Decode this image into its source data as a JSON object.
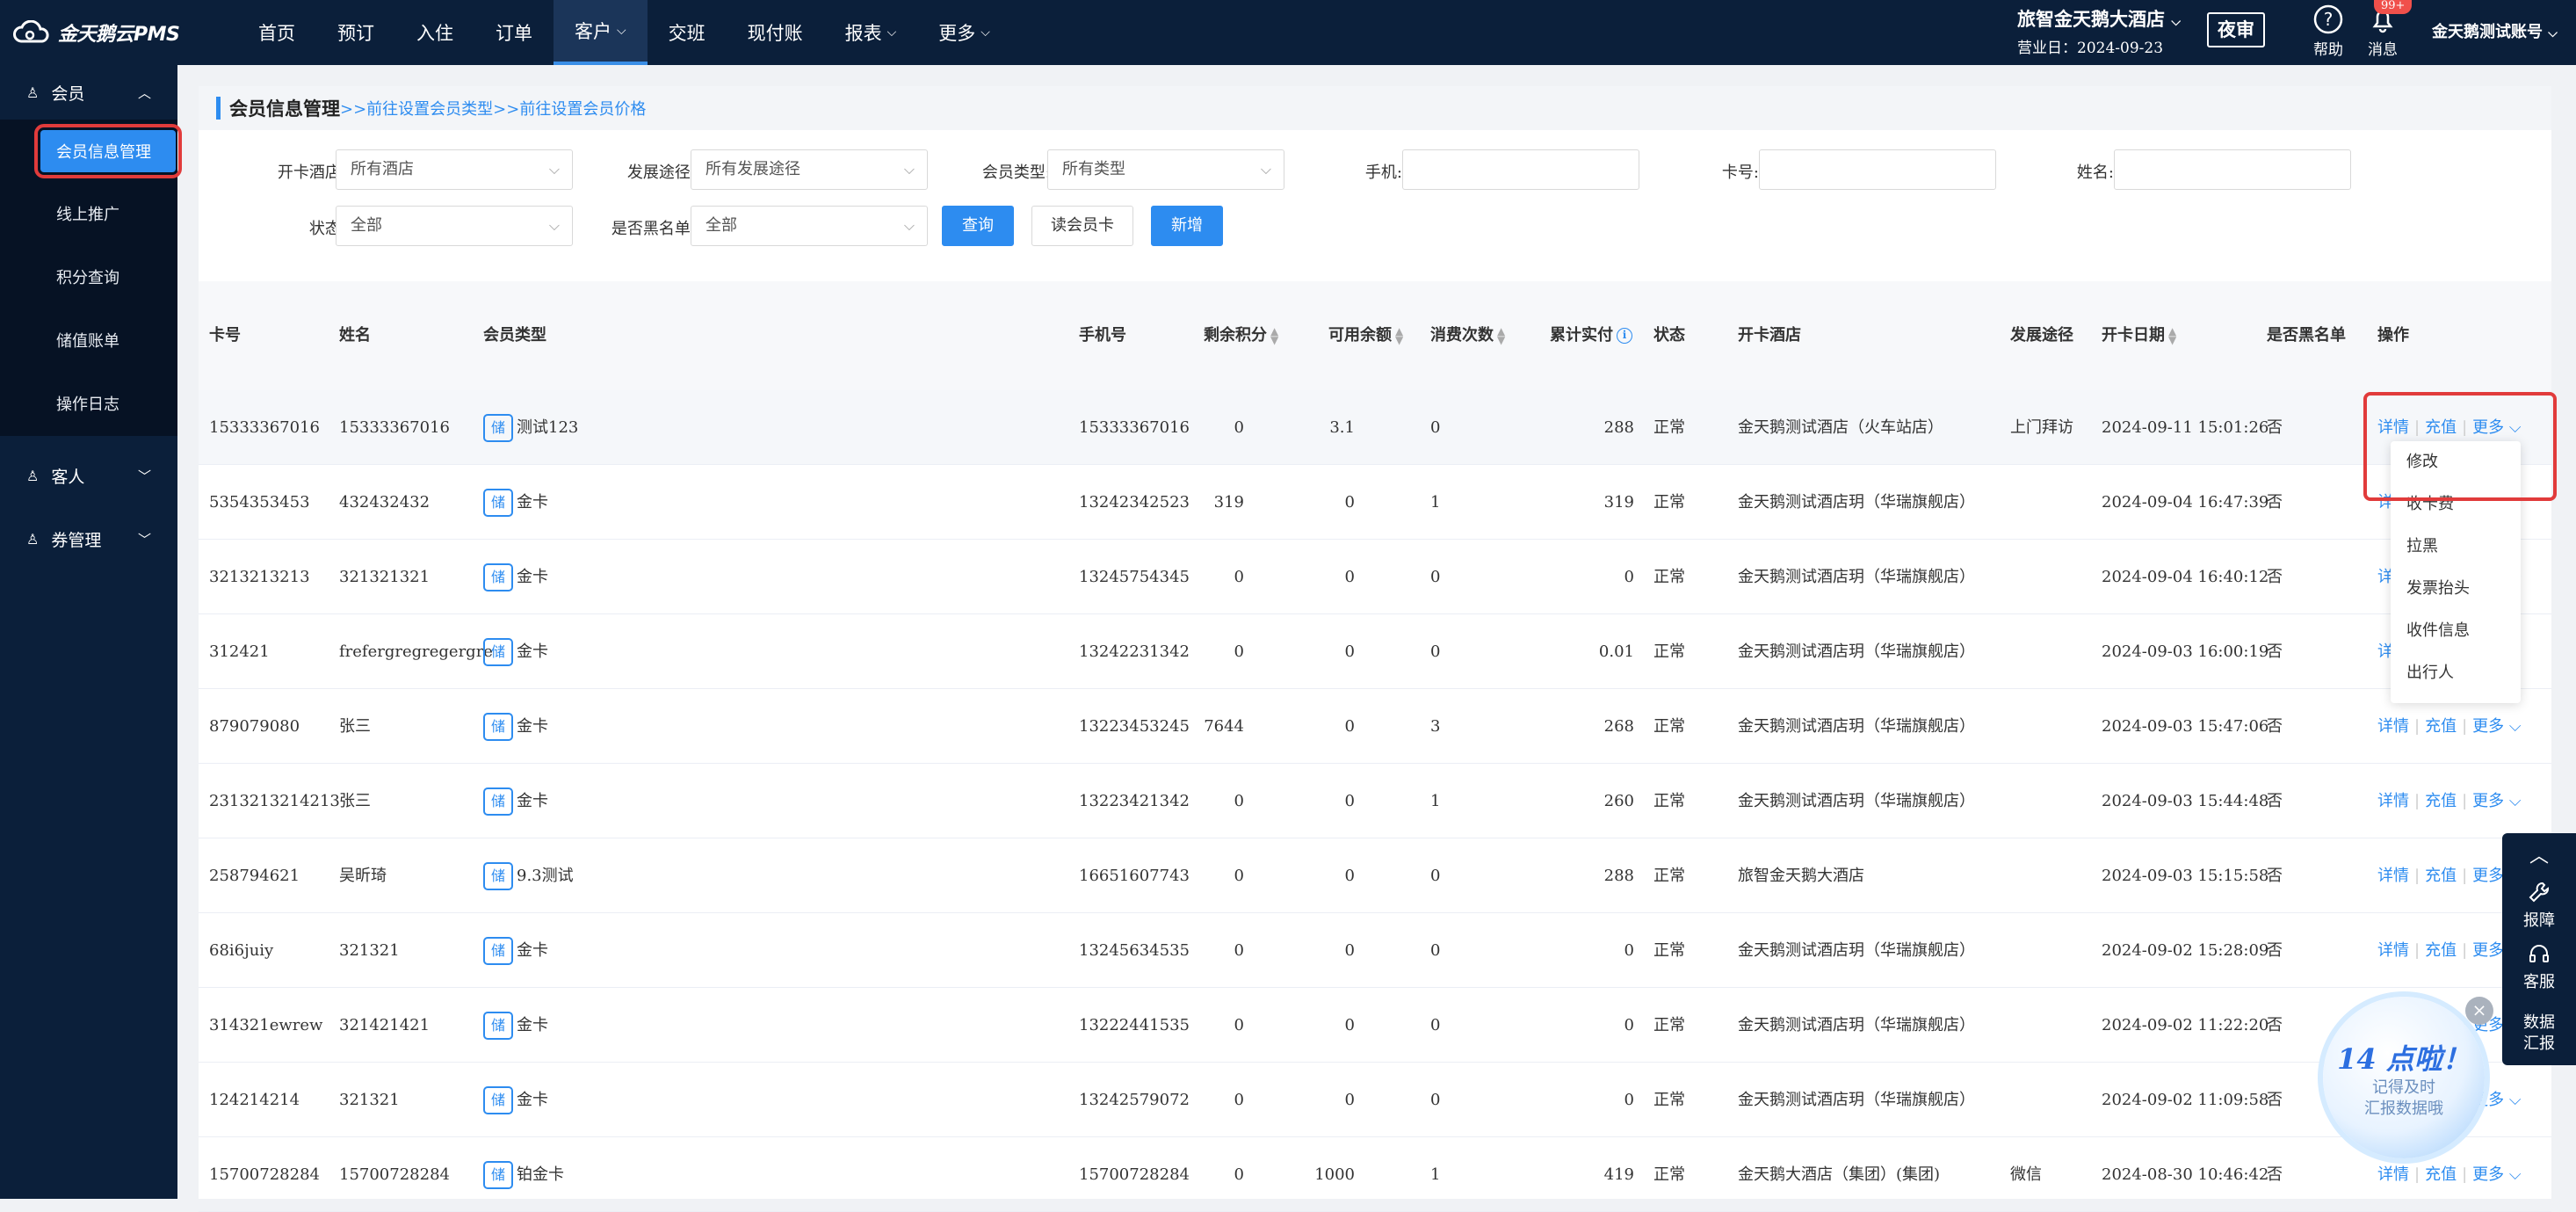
{
  "topbar": {
    "logo_text": "金天鹅云PMS",
    "menu": [
      {
        "label": "首页",
        "has_dropdown": false,
        "active": false
      },
      {
        "label": "预订",
        "has_dropdown": false,
        "active": false
      },
      {
        "label": "入住",
        "has_dropdown": false,
        "active": false
      },
      {
        "label": "订单",
        "has_dropdown": false,
        "active": false
      },
      {
        "label": "客户",
        "has_dropdown": true,
        "active": true
      },
      {
        "label": "交班",
        "has_dropdown": false,
        "active": false
      },
      {
        "label": "现付账",
        "has_dropdown": false,
        "active": false
      },
      {
        "label": "报表",
        "has_dropdown": true,
        "active": false
      },
      {
        "label": "更多",
        "has_dropdown": true,
        "active": false
      }
    ],
    "hotel_name": "旅智金天鹅大酒店",
    "business_date": "营业日：2024-09-23",
    "night_audit_label": "夜审",
    "help_label": "帮助",
    "message_label": "消息",
    "message_badge": "99+",
    "account_label": "金天鹅测试账号"
  },
  "sidebar": {
    "groups": [
      {
        "label": "会员",
        "icon": "user-icon",
        "expanded": true
      },
      {
        "label": "客人",
        "icon": "user-icon",
        "expanded": false
      },
      {
        "label": "券管理",
        "icon": "user-icon",
        "expanded": false
      }
    ],
    "member_items": [
      {
        "label": "会员信息管理",
        "active": true
      },
      {
        "label": "线上推广",
        "active": false
      },
      {
        "label": "积分查询",
        "active": false
      },
      {
        "label": "储值账单",
        "active": false
      },
      {
        "label": "操作日志",
        "active": false
      }
    ]
  },
  "page": {
    "title": "会员信息管理",
    "link1": ">>前往设置会员类型",
    "link2": ">>前往设置会员价格"
  },
  "filters": {
    "open_hotel_label": "开卡酒店:",
    "open_hotel_value": "所有酒店",
    "channel_label": "发展途径:",
    "channel_value": "所有发展途径",
    "member_type_label": "会员类型:",
    "member_type_value": "所有类型",
    "phone_label": "手机:",
    "phone_value": "",
    "card_no_label": "卡号:",
    "card_no_value": "",
    "name_label": "姓名:",
    "name_value": "",
    "status_label": "状态:",
    "status_value": "全部",
    "blacklist_label": "是否黑名单:",
    "blacklist_value": "全部",
    "query_button": "查询",
    "read_card_button": "读会员卡",
    "add_button": "新增"
  },
  "table": {
    "headers": {
      "card_no": "卡号",
      "name": "姓名",
      "member_type": "会员类型",
      "phone": "手机号",
      "points": "剩余积分",
      "balance": "可用余额",
      "consume_count": "消费次数",
      "total_paid": "累计实付",
      "status": "状态",
      "open_hotel": "开卡酒店",
      "channel": "发展途径",
      "open_date": "开卡日期",
      "blacklist": "是否黑名单",
      "actions": "操作"
    },
    "stored_tag": "储",
    "action_labels": {
      "detail": "详情",
      "recharge": "充值",
      "more": "更多"
    },
    "rows": [
      {
        "card_no": "15333367016",
        "name": "15333367016",
        "member_type": "测试123",
        "phone": "15333367016",
        "points": "0",
        "balance": "3.1",
        "consume_count": "0",
        "total_paid": "288",
        "status": "正常",
        "open_hotel": "金天鹅测试酒店（火车站店）",
        "channel": "上门拜访",
        "open_date": "2024-09-11 15:01:26",
        "blacklist": "否"
      },
      {
        "card_no": "5354353453",
        "name": "432432432",
        "member_type": "金卡",
        "phone": "13242342523",
        "points": "319",
        "balance": "0",
        "consume_count": "1",
        "total_paid": "319",
        "status": "正常",
        "open_hotel": "金天鹅测试酒店玥（华瑞旗舰店）",
        "channel": "",
        "open_date": "2024-09-04 16:47:39",
        "blacklist": "否"
      },
      {
        "card_no": "3213213213",
        "name": "321321321",
        "member_type": "金卡",
        "phone": "13245754345",
        "points": "0",
        "balance": "0",
        "consume_count": "0",
        "total_paid": "0",
        "status": "正常",
        "open_hotel": "金天鹅测试酒店玥（华瑞旗舰店）",
        "channel": "",
        "open_date": "2024-09-04 16:40:12",
        "blacklist": "否"
      },
      {
        "card_no": "312421",
        "name": "frefergregregergre",
        "member_type": "金卡",
        "phone": "13242231342",
        "points": "0",
        "balance": "0",
        "consume_count": "0",
        "total_paid": "0.01",
        "status": "正常",
        "open_hotel": "金天鹅测试酒店玥（华瑞旗舰店）",
        "channel": "",
        "open_date": "2024-09-03 16:00:19",
        "blacklist": "否"
      },
      {
        "card_no": "879079080",
        "name": "张三",
        "member_type": "金卡",
        "phone": "13223453245",
        "points": "7644",
        "balance": "0",
        "consume_count": "3",
        "total_paid": "268",
        "status": "正常",
        "open_hotel": "金天鹅测试酒店玥（华瑞旗舰店）",
        "channel": "",
        "open_date": "2024-09-03 15:47:06",
        "blacklist": "否"
      },
      {
        "card_no": "2313213214213",
        "name": "张三",
        "member_type": "金卡",
        "phone": "13223421342",
        "points": "0",
        "balance": "0",
        "consume_count": "1",
        "total_paid": "260",
        "status": "正常",
        "open_hotel": "金天鹅测试酒店玥（华瑞旗舰店）",
        "channel": "",
        "open_date": "2024-09-03 15:44:48",
        "blacklist": "否"
      },
      {
        "card_no": "258794621",
        "name": "吴昕琦",
        "member_type": "9.3测试",
        "phone": "16651607743",
        "points": "0",
        "balance": "0",
        "consume_count": "0",
        "total_paid": "288",
        "status": "正常",
        "open_hotel": "旅智金天鹅大酒店",
        "channel": "",
        "open_date": "2024-09-03 15:15:58",
        "blacklist": "否"
      },
      {
        "card_no": "68i6juiy",
        "name": "321321",
        "member_type": "金卡",
        "phone": "13245634535",
        "points": "0",
        "balance": "0",
        "consume_count": "0",
        "total_paid": "0",
        "status": "正常",
        "open_hotel": "金天鹅测试酒店玥（华瑞旗舰店）",
        "channel": "",
        "open_date": "2024-09-02 15:28:09",
        "blacklist": "否"
      },
      {
        "card_no": "314321ewrew",
        "name": "321421421",
        "member_type": "金卡",
        "phone": "13222441535",
        "points": "0",
        "balance": "0",
        "consume_count": "0",
        "total_paid": "0",
        "status": "正常",
        "open_hotel": "金天鹅测试酒店玥（华瑞旗舰店）",
        "channel": "",
        "open_date": "2024-09-02 11:22:20",
        "blacklist": "否"
      },
      {
        "card_no": "124214214",
        "name": "321321",
        "member_type": "金卡",
        "phone": "13242579072",
        "points": "0",
        "balance": "0",
        "consume_count": "0",
        "total_paid": "0",
        "status": "正常",
        "open_hotel": "金天鹅测试酒店玥（华瑞旗舰店）",
        "channel": "",
        "open_date": "2024-09-02 11:09:58",
        "blacklist": "否"
      },
      {
        "card_no": "15700728284",
        "name": "15700728284",
        "member_type": "铂金卡",
        "phone": "15700728284",
        "points": "0",
        "balance": "1000",
        "consume_count": "1",
        "total_paid": "419",
        "status": "正常",
        "open_hotel": "金天鹅大酒店（集团）(集团)",
        "channel": "微信",
        "open_date": "2024-08-30 10:46:42",
        "blacklist": "否"
      }
    ]
  },
  "more_menu": {
    "items": [
      "修改",
      "收卡费",
      "拉黑",
      "发票抬头",
      "收件信息",
      "出行人"
    ]
  },
  "side_tools": {
    "report_label": "报障",
    "service_label": "客服",
    "data_label_1": "数据",
    "data_label_2": "汇报"
  },
  "promo": {
    "headline": "14 点啦！",
    "line1": "记得及时",
    "line2": "汇报数据哦"
  }
}
